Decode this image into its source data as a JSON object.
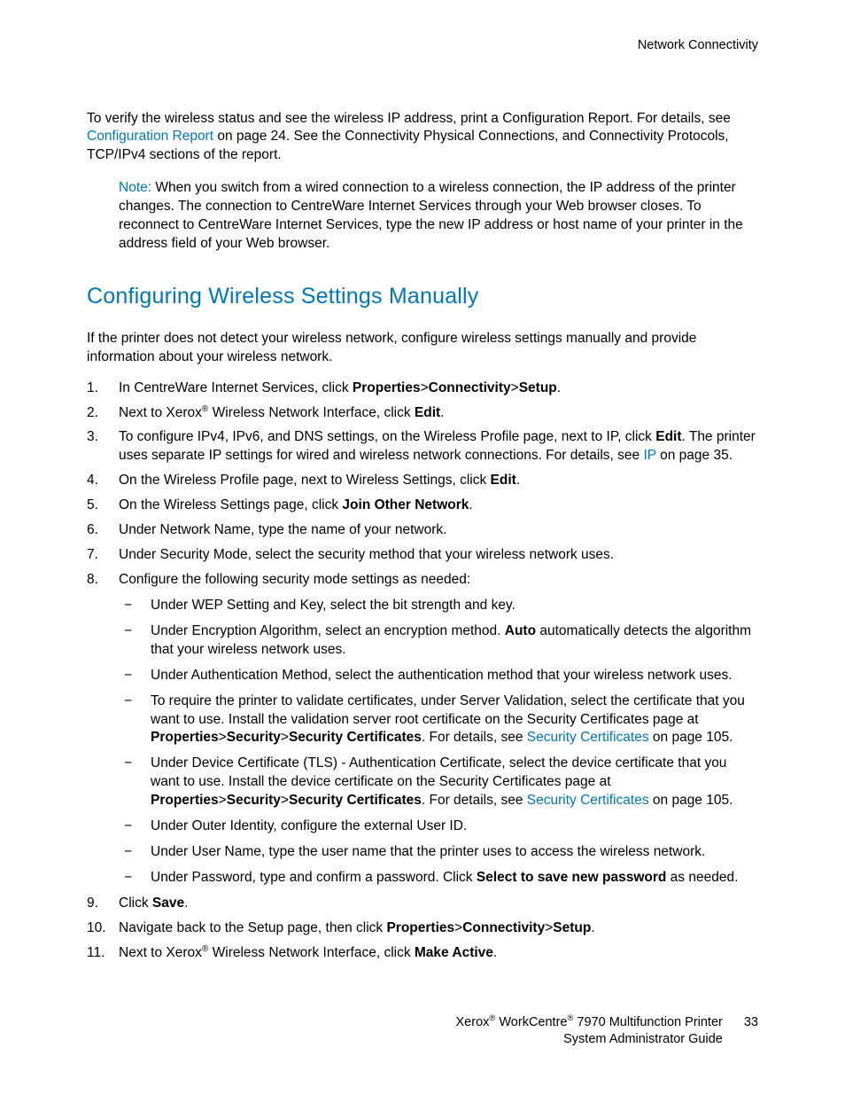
{
  "header": {
    "section": "Network Connectivity"
  },
  "intro": {
    "p1a": "To verify the wireless status and see the wireless IP address, print a Configuration Report. For details, see ",
    "link1": "Configuration Report",
    "p1b": " on page 24. See the Connectivity Physical Connections, and Connectivity Protocols, TCP/IPv4 sections of the report."
  },
  "note": {
    "label": "Note:",
    "text": " When you switch from a wired connection to a wireless connection, the IP address of the printer changes. The connection to CentreWare Internet Services through your Web browser closes. To reconnect to CentreWare Internet Services, type the new IP address or host name of your printer in the address field of your Web browser."
  },
  "heading": "Configuring Wireless Settings Manually",
  "sectionIntro": "If the printer does not detect your wireless network, configure wireless settings manually and provide information about your wireless network.",
  "steps": {
    "s1": {
      "a": "In CentreWare Internet Services, click ",
      "b": "Properties",
      "c": ">",
      "d": "Connectivity",
      "e": ">",
      "f": "Setup",
      "g": "."
    },
    "s2": {
      "a": "Next to Xerox",
      "reg": "®",
      "b": " Wireless Network Interface, click ",
      "c": "Edit",
      "d": "."
    },
    "s3": {
      "a": "To configure IPv4, IPv6, and DNS settings, on the Wireless Profile page, next to IP, click ",
      "b": "Edit",
      "c": ". The printer uses separate IP settings for wired and wireless network connections. For details, see ",
      "link": "IP",
      "d": " on page 35."
    },
    "s4": {
      "a": "On the Wireless Profile page, next to Wireless Settings, click ",
      "b": "Edit",
      "c": "."
    },
    "s5": {
      "a": "On the Wireless Settings page, click ",
      "b": "Join Other Network",
      "c": "."
    },
    "s6": {
      "a": "Under Network Name, type the name of your network."
    },
    "s7": {
      "a": "Under Security Mode, select the security method that your wireless network uses."
    },
    "s8": {
      "a": "Configure the following security mode settings as needed:",
      "sub": {
        "i1": "Under WEP Setting and Key, select the bit strength and key.",
        "i2": {
          "a": "Under Encryption Algorithm, select an encryption method. ",
          "b": "Auto",
          "c": " automatically detects the algorithm that your wireless network uses."
        },
        "i3": "Under Authentication Method, select the authentication method that your wireless network uses.",
        "i4": {
          "a": "To require the printer to validate certificates, under Server Validation, select the certificate that you want to use. Install the validation server root certificate on the Security Certificates page at ",
          "b": "Properties",
          "c": ">",
          "d": "Security",
          "e": ">",
          "f": "Security Certificates",
          "g": ". For details, see ",
          "link": "Security Certificates",
          "h": " on page 105."
        },
        "i5": {
          "a": "Under Device Certificate (TLS) - Authentication Certificate, select the device certificate that you want to use. Install the device certificate on the Security Certificates page at ",
          "b": "Properties",
          "c": ">",
          "d": "Security",
          "e": ">",
          "f": "Security Certificates",
          "g": ". For details, see ",
          "link": "Security Certificates",
          "h": " on page 105."
        },
        "i6": "Under Outer Identity, configure the external User ID.",
        "i7": "Under User Name, type the user name that the printer uses to access the wireless network.",
        "i8": {
          "a": "Under Password, type and confirm a password. Click ",
          "b": "Select to save new password",
          "c": " as needed."
        }
      }
    },
    "s9": {
      "a": "Click ",
      "b": "Save",
      "c": "."
    },
    "s10": {
      "a": "Navigate back to the Setup page, then click ",
      "b": "Properties",
      "c": ">",
      "d": "Connectivity",
      "e": ">",
      "f": "Setup",
      "g": "."
    },
    "s11": {
      "a": "Next to Xerox",
      "reg": "®",
      "b": " Wireless Network Interface, click ",
      "c": "Make Active",
      "d": "."
    }
  },
  "footer": {
    "line1a": "Xerox",
    "reg1": "®",
    "line1b": " WorkCentre",
    "reg2": "®",
    "line1c": " 7970 Multifunction Printer",
    "line2": "System Administrator Guide",
    "page": "33"
  }
}
